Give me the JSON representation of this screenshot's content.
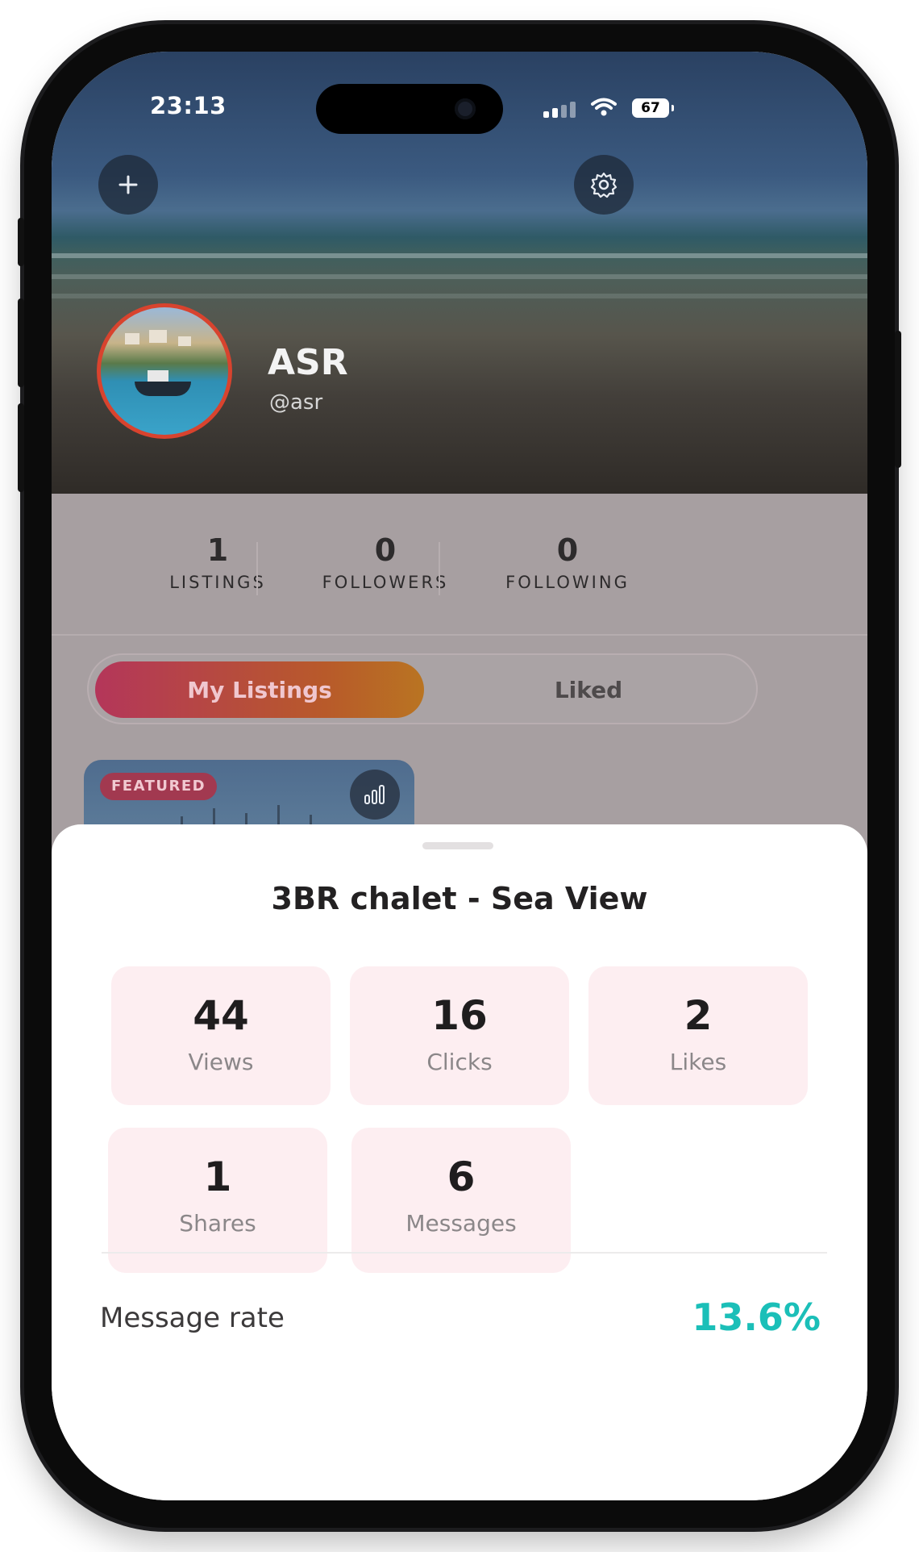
{
  "status_bar": {
    "time": "23:13",
    "battery": "67",
    "icons": [
      "signal-icon",
      "wifi-icon",
      "battery-icon"
    ]
  },
  "header": {
    "add_icon": "plus-icon",
    "settings_icon": "gear-icon"
  },
  "profile": {
    "name": "ASR",
    "handle": "@asr"
  },
  "stats": [
    {
      "value": "1",
      "label": "LISTINGS"
    },
    {
      "value": "0",
      "label": "FOLLOWERS"
    },
    {
      "value": "0",
      "label": "FOLLOWING"
    }
  ],
  "tabs": {
    "active": "My Listings",
    "inactive": "Liked"
  },
  "listing_card": {
    "badge": "FEATURED",
    "analytics_icon": "bar-chart-icon"
  },
  "sheet": {
    "title": "3BR chalet - Sea View",
    "metrics": [
      {
        "value": "44",
        "label": "Views"
      },
      {
        "value": "16",
        "label": "Clicks"
      },
      {
        "value": "2",
        "label": "Likes"
      },
      {
        "value": "1",
        "label": "Shares"
      },
      {
        "value": "6",
        "label": "Messages"
      }
    ],
    "rate_label": "Message rate",
    "rate_value": "13.6%"
  },
  "colors": {
    "accent_gradient_start": "#b4365a",
    "accent_gradient_end": "#b97422",
    "metric_card_bg": "#fdeef1",
    "rate_color": "#1bbfb8"
  }
}
